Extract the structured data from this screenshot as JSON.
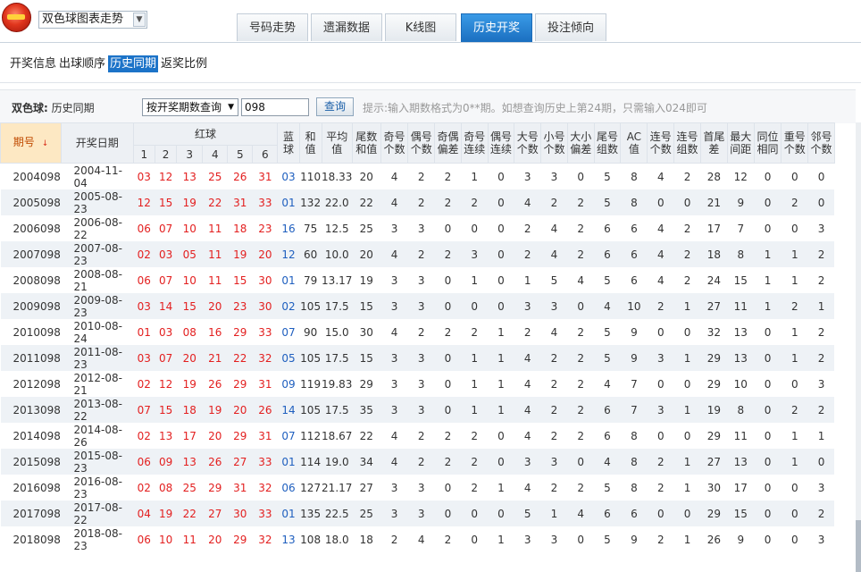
{
  "header": {
    "selector_value": "双色球图表走势",
    "tabs": [
      "号码走势",
      "遗漏数据",
      "K线图",
      "历史开奖",
      "投注倾向"
    ],
    "active_tab_index": 3
  },
  "subnav": {
    "items": [
      "开奖信息",
      "出球顺序",
      "历史同期",
      "返奖比例"
    ],
    "active_index": 2
  },
  "query": {
    "label_bold": "双色球:",
    "label_text": " 历史同期",
    "select_value": "按开奖期数查询",
    "input_value": "098",
    "button_label": "查询",
    "hint": "提示:输入期数格式为0**期。如想查询历史上第24期，只需输入024即可"
  },
  "table": {
    "headers": {
      "issue": "期号",
      "date": "开奖日期",
      "red": "红球",
      "red_sub": [
        "1",
        "2",
        "3",
        "4",
        "5",
        "6"
      ],
      "blue_l1": "蓝",
      "blue_l2": "球",
      "stats": [
        [
          "和",
          "值"
        ],
        [
          "平均",
          "值"
        ],
        [
          "尾数",
          "和值"
        ],
        [
          "奇号",
          "个数"
        ],
        [
          "偶号",
          "个数"
        ],
        [
          "奇偶",
          "偏差"
        ],
        [
          "奇号",
          "连续"
        ],
        [
          "偶号",
          "连续"
        ],
        [
          "大号",
          "个数"
        ],
        [
          "小号",
          "个数"
        ],
        [
          "大小",
          "偏差"
        ],
        [
          "尾号",
          "组数"
        ],
        [
          "AC",
          "值"
        ],
        [
          "连号",
          "个数"
        ],
        [
          "连号",
          "组数"
        ],
        [
          "首尾",
          "差"
        ],
        [
          "最大",
          "间距"
        ],
        [
          "同位",
          "相同"
        ],
        [
          "重号",
          "个数"
        ],
        [
          "邻号",
          "个数"
        ]
      ]
    },
    "rows": [
      {
        "issue": "2004098",
        "date": "2004-11-04",
        "red": [
          "03",
          "12",
          "13",
          "25",
          "26",
          "31"
        ],
        "blue": "03",
        "stats": [
          "110",
          "18.33",
          "20",
          "4",
          "2",
          "2",
          "1",
          "0",
          "3",
          "3",
          "0",
          "5",
          "8",
          "4",
          "2",
          "28",
          "12",
          "0",
          "0",
          "0"
        ]
      },
      {
        "issue": "2005098",
        "date": "2005-08-23",
        "red": [
          "12",
          "15",
          "19",
          "22",
          "31",
          "33"
        ],
        "blue": "01",
        "stats": [
          "132",
          "22.0",
          "22",
          "4",
          "2",
          "2",
          "2",
          "0",
          "4",
          "2",
          "2",
          "5",
          "8",
          "0",
          "0",
          "21",
          "9",
          "0",
          "2",
          "0"
        ]
      },
      {
        "issue": "2006098",
        "date": "2006-08-22",
        "red": [
          "06",
          "07",
          "10",
          "11",
          "18",
          "23"
        ],
        "blue": "16",
        "stats": [
          "75",
          "12.5",
          "25",
          "3",
          "3",
          "0",
          "0",
          "0",
          "2",
          "4",
          "2",
          "6",
          "6",
          "4",
          "2",
          "17",
          "7",
          "0",
          "0",
          "3"
        ]
      },
      {
        "issue": "2007098",
        "date": "2007-08-23",
        "red": [
          "02",
          "03",
          "05",
          "11",
          "19",
          "20"
        ],
        "blue": "12",
        "stats": [
          "60",
          "10.0",
          "20",
          "4",
          "2",
          "2",
          "3",
          "0",
          "2",
          "4",
          "2",
          "6",
          "6",
          "4",
          "2",
          "18",
          "8",
          "1",
          "1",
          "2"
        ]
      },
      {
        "issue": "2008098",
        "date": "2008-08-21",
        "red": [
          "06",
          "07",
          "10",
          "11",
          "15",
          "30"
        ],
        "blue": "01",
        "stats": [
          "79",
          "13.17",
          "19",
          "3",
          "3",
          "0",
          "1",
          "0",
          "1",
          "5",
          "4",
          "5",
          "6",
          "4",
          "2",
          "24",
          "15",
          "1",
          "1",
          "2"
        ]
      },
      {
        "issue": "2009098",
        "date": "2009-08-23",
        "red": [
          "03",
          "14",
          "15",
          "20",
          "23",
          "30"
        ],
        "blue": "02",
        "stats": [
          "105",
          "17.5",
          "15",
          "3",
          "3",
          "0",
          "0",
          "0",
          "3",
          "3",
          "0",
          "4",
          "10",
          "2",
          "1",
          "27",
          "11",
          "1",
          "2",
          "1"
        ]
      },
      {
        "issue": "2010098",
        "date": "2010-08-24",
        "red": [
          "01",
          "03",
          "08",
          "16",
          "29",
          "33"
        ],
        "blue": "07",
        "stats": [
          "90",
          "15.0",
          "30",
          "4",
          "2",
          "2",
          "2",
          "1",
          "2",
          "4",
          "2",
          "5",
          "9",
          "0",
          "0",
          "32",
          "13",
          "0",
          "1",
          "2"
        ]
      },
      {
        "issue": "2011098",
        "date": "2011-08-23",
        "red": [
          "03",
          "07",
          "20",
          "21",
          "22",
          "32"
        ],
        "blue": "05",
        "stats": [
          "105",
          "17.5",
          "15",
          "3",
          "3",
          "0",
          "1",
          "1",
          "4",
          "2",
          "2",
          "5",
          "9",
          "3",
          "1",
          "29",
          "13",
          "0",
          "1",
          "2"
        ]
      },
      {
        "issue": "2012098",
        "date": "2012-08-21",
        "red": [
          "02",
          "12",
          "19",
          "26",
          "29",
          "31"
        ],
        "blue": "09",
        "stats": [
          "119",
          "19.83",
          "29",
          "3",
          "3",
          "0",
          "1",
          "1",
          "4",
          "2",
          "2",
          "4",
          "7",
          "0",
          "0",
          "29",
          "10",
          "0",
          "0",
          "3"
        ]
      },
      {
        "issue": "2013098",
        "date": "2013-08-22",
        "red": [
          "07",
          "15",
          "18",
          "19",
          "20",
          "26"
        ],
        "blue": "14",
        "stats": [
          "105",
          "17.5",
          "35",
          "3",
          "3",
          "0",
          "1",
          "1",
          "4",
          "2",
          "2",
          "6",
          "7",
          "3",
          "1",
          "19",
          "8",
          "0",
          "2",
          "2"
        ]
      },
      {
        "issue": "2014098",
        "date": "2014-08-26",
        "red": [
          "02",
          "13",
          "17",
          "20",
          "29",
          "31"
        ],
        "blue": "07",
        "stats": [
          "112",
          "18.67",
          "22",
          "4",
          "2",
          "2",
          "2",
          "0",
          "4",
          "2",
          "2",
          "6",
          "8",
          "0",
          "0",
          "29",
          "11",
          "0",
          "1",
          "1"
        ]
      },
      {
        "issue": "2015098",
        "date": "2015-08-23",
        "red": [
          "06",
          "09",
          "13",
          "26",
          "27",
          "33"
        ],
        "blue": "01",
        "stats": [
          "114",
          "19.0",
          "34",
          "4",
          "2",
          "2",
          "2",
          "0",
          "3",
          "3",
          "0",
          "4",
          "8",
          "2",
          "1",
          "27",
          "13",
          "0",
          "1",
          "0"
        ]
      },
      {
        "issue": "2016098",
        "date": "2016-08-23",
        "red": [
          "02",
          "08",
          "25",
          "29",
          "31",
          "32"
        ],
        "blue": "06",
        "stats": [
          "127",
          "21.17",
          "27",
          "3",
          "3",
          "0",
          "2",
          "1",
          "4",
          "2",
          "2",
          "5",
          "8",
          "2",
          "1",
          "30",
          "17",
          "0",
          "0",
          "3"
        ]
      },
      {
        "issue": "2017098",
        "date": "2017-08-22",
        "red": [
          "04",
          "19",
          "22",
          "27",
          "30",
          "33"
        ],
        "blue": "01",
        "stats": [
          "135",
          "22.5",
          "25",
          "3",
          "3",
          "0",
          "0",
          "0",
          "5",
          "1",
          "4",
          "6",
          "6",
          "0",
          "0",
          "29",
          "15",
          "0",
          "0",
          "2"
        ]
      },
      {
        "issue": "2018098",
        "date": "2018-08-23",
        "red": [
          "06",
          "10",
          "11",
          "20",
          "29",
          "32"
        ],
        "blue": "13",
        "stats": [
          "108",
          "18.0",
          "18",
          "2",
          "4",
          "2",
          "0",
          "1",
          "3",
          "3",
          "0",
          "5",
          "9",
          "2",
          "1",
          "26",
          "9",
          "0",
          "0",
          "3"
        ]
      }
    ]
  }
}
